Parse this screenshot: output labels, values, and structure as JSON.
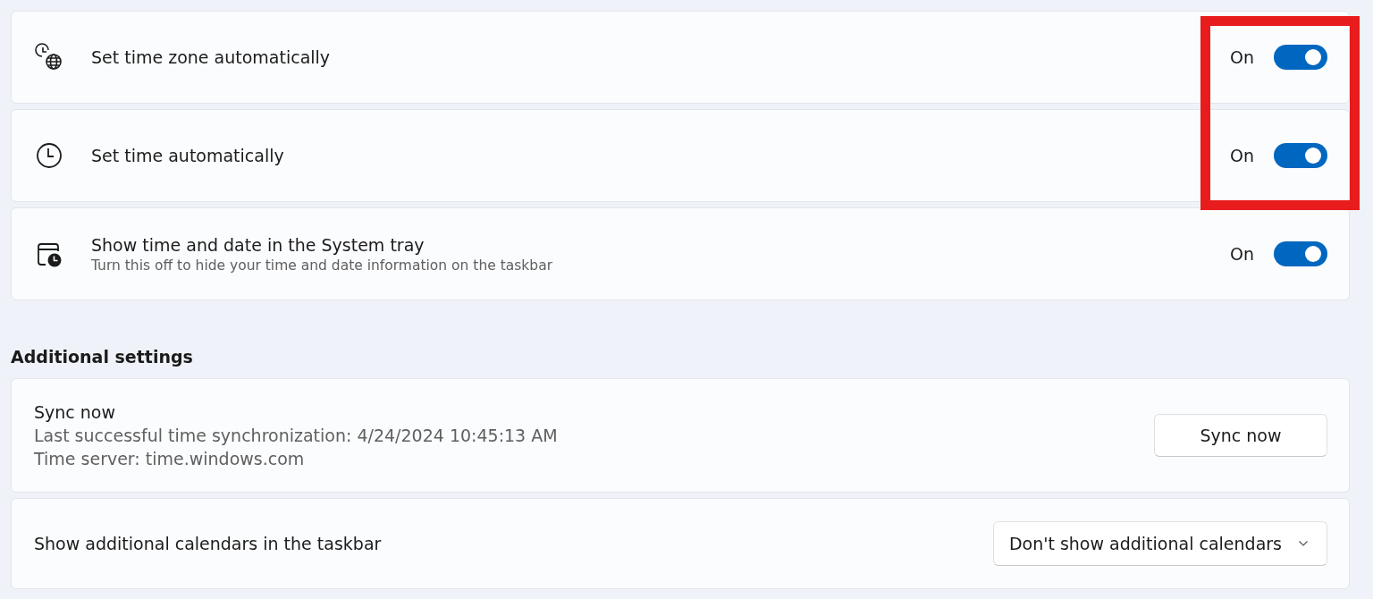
{
  "toggle_settings": [
    {
      "kind": "clock-globe",
      "title": "Set time zone automatically",
      "state_label": "On",
      "on": true
    },
    {
      "kind": "clock",
      "title": "Set time automatically",
      "state_label": "On",
      "on": true
    },
    {
      "kind": "calendar-clock",
      "title": "Show time and date in the System tray",
      "description": "Turn this off to hide your time and date information on the taskbar",
      "state_label": "On",
      "on": true
    }
  ],
  "highlight": {
    "kind": "frame",
    "color": "#e81c1c"
  },
  "additional_settings": {
    "heading": "Additional settings",
    "sync": {
      "title": "Sync now",
      "lines": [
        "Last successful time synchronization: 4/24/2024 10:45:13 AM",
        "Time server: time.windows.com"
      ],
      "button": "Sync now"
    },
    "calendars": {
      "title": "Show additional calendars in the taskbar",
      "value": "Don't show additional calendars"
    }
  }
}
